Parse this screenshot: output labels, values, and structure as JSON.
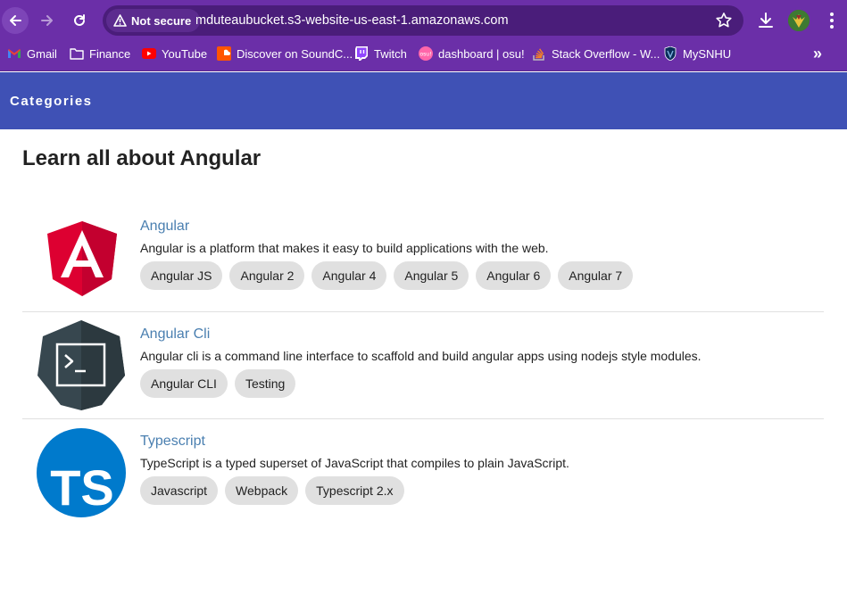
{
  "browser": {
    "security_label": "Not secure",
    "url": "mduteaubucket.s3-website-us-east-1.amazonaws.com"
  },
  "bookmarks": [
    {
      "label": "Gmail",
      "icon": "gmail-icon"
    },
    {
      "label": "Finance",
      "icon": "folder-icon"
    },
    {
      "label": "YouTube",
      "icon": "youtube-icon"
    },
    {
      "label": "Discover on SoundC...",
      "icon": "soundcloud-icon"
    },
    {
      "label": "Twitch",
      "icon": "twitch-icon"
    },
    {
      "label": "dashboard | osu!",
      "icon": "osu-icon"
    },
    {
      "label": "Stack Overflow - W...",
      "icon": "stackoverflow-icon"
    },
    {
      "label": "MySNHU",
      "icon": "snhu-icon"
    }
  ],
  "header": {
    "title": "Categories"
  },
  "main": {
    "heading": "Learn all about Angular",
    "categories": [
      {
        "name": "Angular",
        "description": "Angular is a platform that makes it easy to build applications with the web.",
        "logo": "angular-logo",
        "chips": [
          "Angular JS",
          "Angular 2",
          "Angular 4",
          "Angular 5",
          "Angular 6",
          "Angular 7"
        ]
      },
      {
        "name": "Angular Cli",
        "description": "Angular cli is a command line interface to scaffold and build angular apps using nodejs style modules.",
        "logo": "terminal-logo",
        "chips": [
          "Angular CLI",
          "Testing"
        ]
      },
      {
        "name": "Typescript",
        "description": "TypeScript is a typed superset of JavaScript that compiles to plain JavaScript.",
        "logo": "typescript-logo",
        "logo_text": "TS",
        "chips": [
          "Javascript",
          "Webpack",
          "Typescript 2.x"
        ]
      }
    ]
  },
  "colors": {
    "browser_frame": "#6b2fa8",
    "app_header": "#3f51b5",
    "link": "#4a7fb0",
    "chip_bg": "#e0e0e0",
    "angular_red": "#dd0031",
    "typescript_blue": "#007acc"
  }
}
